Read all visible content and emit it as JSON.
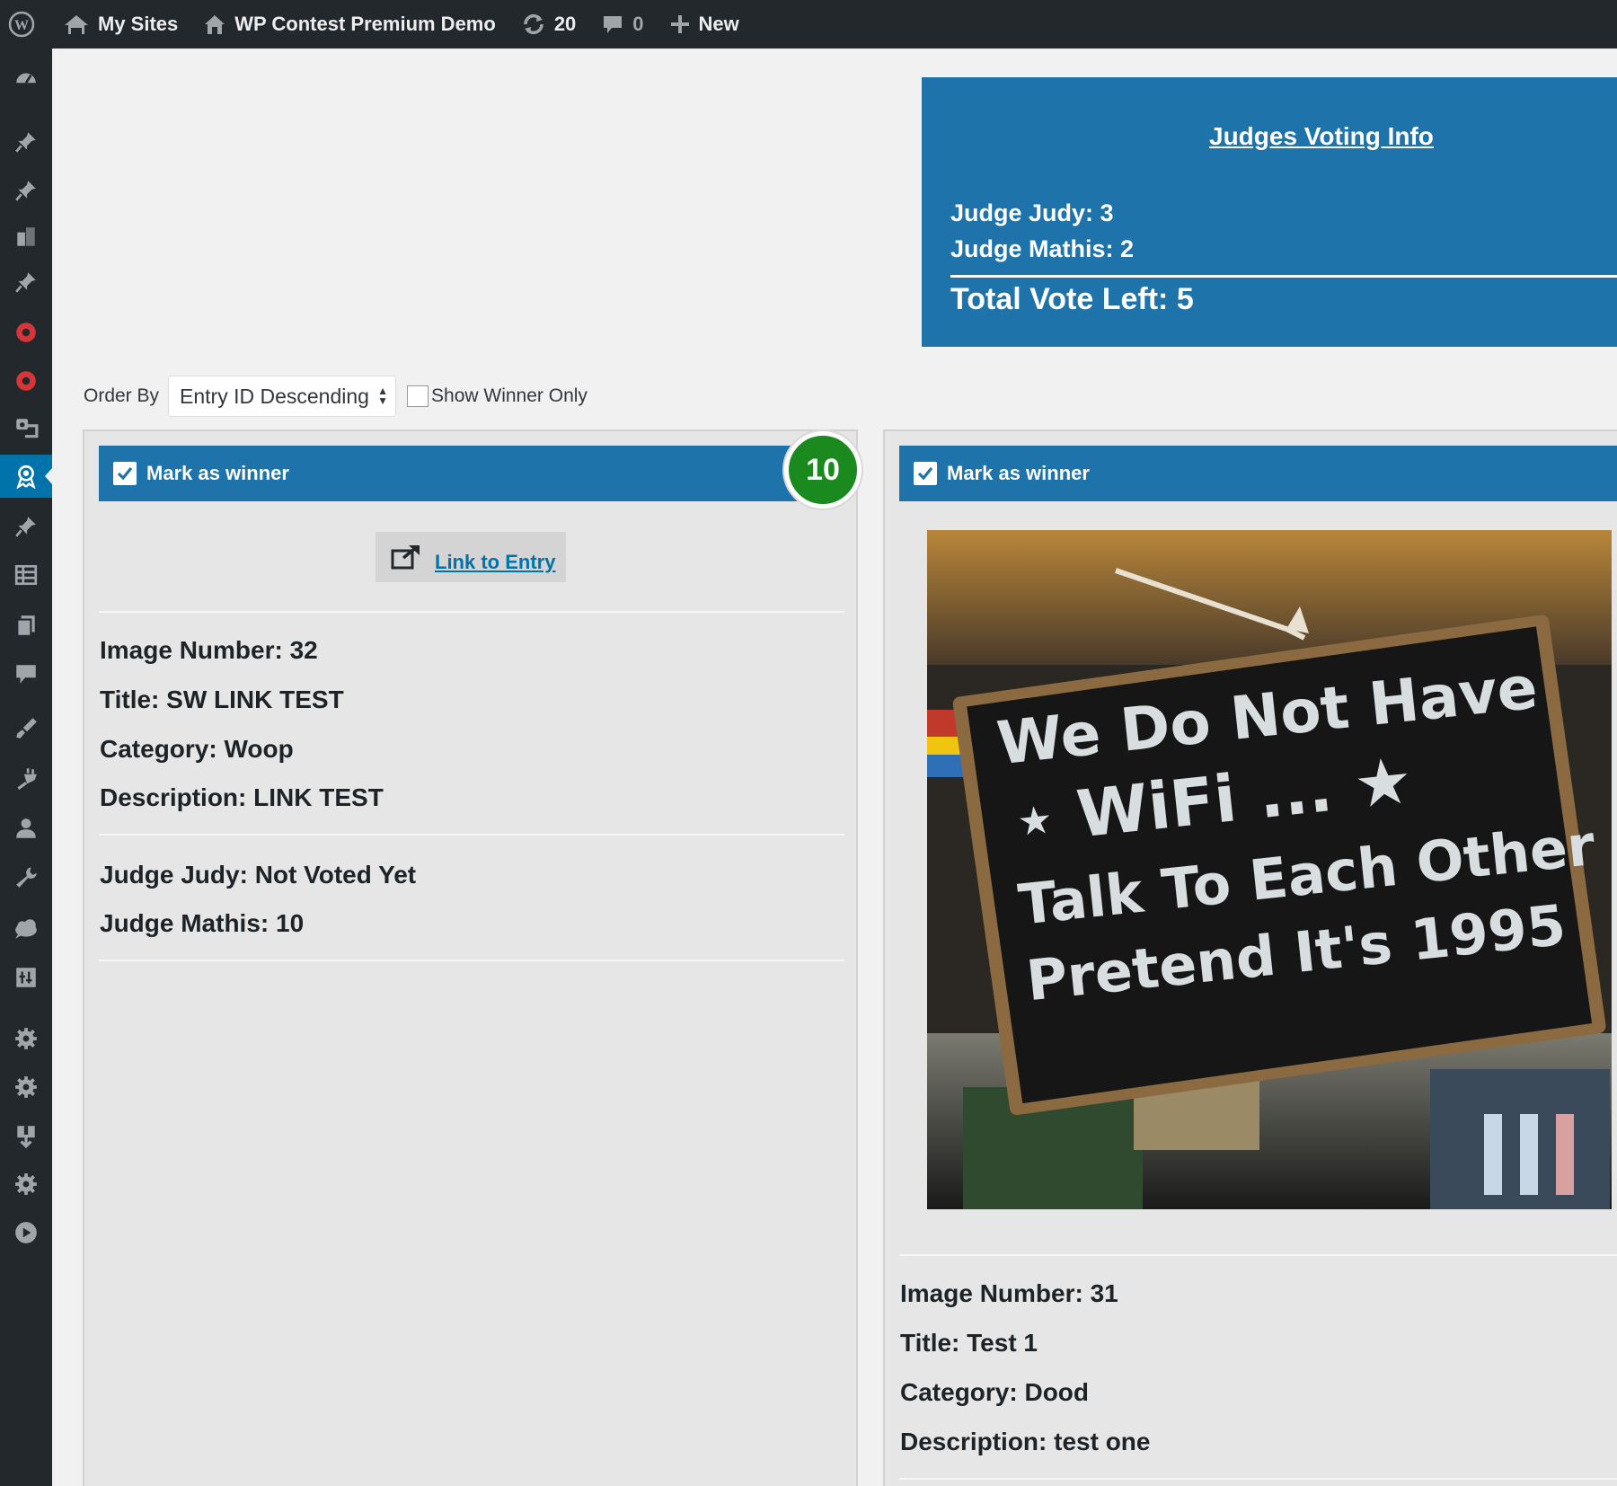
{
  "adminbar": {
    "my_sites": "My Sites",
    "site_name": "WP Contest Premium Demo",
    "updates_count": "20",
    "comments_count": "0",
    "new_label": "New"
  },
  "judges_info": {
    "title": "Judges Voting Info",
    "lines": [
      "Judge Judy: 3",
      "Judge Mathis: 2"
    ],
    "total": "Total Vote Left: 5"
  },
  "filters": {
    "order_by_label": "Order By",
    "order_by_value": "Entry ID Descending",
    "show_winner_label": "Show Winner Only"
  },
  "entries": [
    {
      "winner_label": "Mark as winner",
      "score": "10",
      "link_label": "Link to Entry",
      "image_number": "Image Number: 32",
      "title": "Title: SW LINK TEST",
      "category": "Category: Woop",
      "description": "Description: LINK TEST",
      "votes": [
        "Judge Judy: Not Voted Yet",
        "Judge Mathis: 10"
      ]
    },
    {
      "winner_label": "Mark as winner",
      "photo_sign": [
        "We Do Not Have",
        "⋆ WiFi ... ★",
        "Talk To Each Other",
        "Pretend It's 1995"
      ],
      "image_number": "Image Number: 31",
      "title": "Title: Test 1",
      "category": "Category: Dood",
      "description": "Description: test one"
    }
  ],
  "colors": {
    "adminbar": "#23282d",
    "accent": "#1e73aa",
    "score_badge": "#1a8a1f",
    "link": "#0073aa"
  },
  "sidebar_icons": [
    "dashboard-icon",
    "pin-icon",
    "pin-icon",
    "block-icon",
    "pin-icon",
    "target-icon",
    "target-icon",
    "media-icon",
    "award-icon",
    "pin-icon",
    "table-icon",
    "pages-icon",
    "comment-icon",
    "brush-icon",
    "plugin-icon",
    "user-icon",
    "wrench-icon",
    "cloud-icon",
    "tools-icon",
    "gear-icon",
    "gear-icon",
    "download-icon",
    "gear-icon",
    "play-icon"
  ]
}
